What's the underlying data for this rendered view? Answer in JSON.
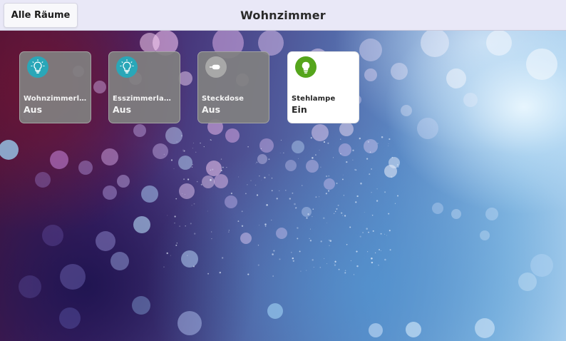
{
  "header": {
    "back_label": "Alle Räume",
    "title": "Wohnzimmer"
  },
  "devices": [
    {
      "name": "Wohnzimmerla…",
      "state": "Aus",
      "icon": "bulb-icon",
      "icon_color": "#2aa7b8",
      "on": false
    },
    {
      "name": "Esszimmerlam…",
      "state": "Aus",
      "icon": "bulb-icon",
      "icon_color": "#2aa7b8",
      "on": false
    },
    {
      "name": "Steckdose",
      "state": "Aus",
      "icon": "plug-icon",
      "icon_color": "#a8a8a8",
      "on": false
    },
    {
      "name": "Stehlampe",
      "state": "Ein",
      "icon": "bulb-icon",
      "icon_color": "#55a51c",
      "on": true
    }
  ]
}
